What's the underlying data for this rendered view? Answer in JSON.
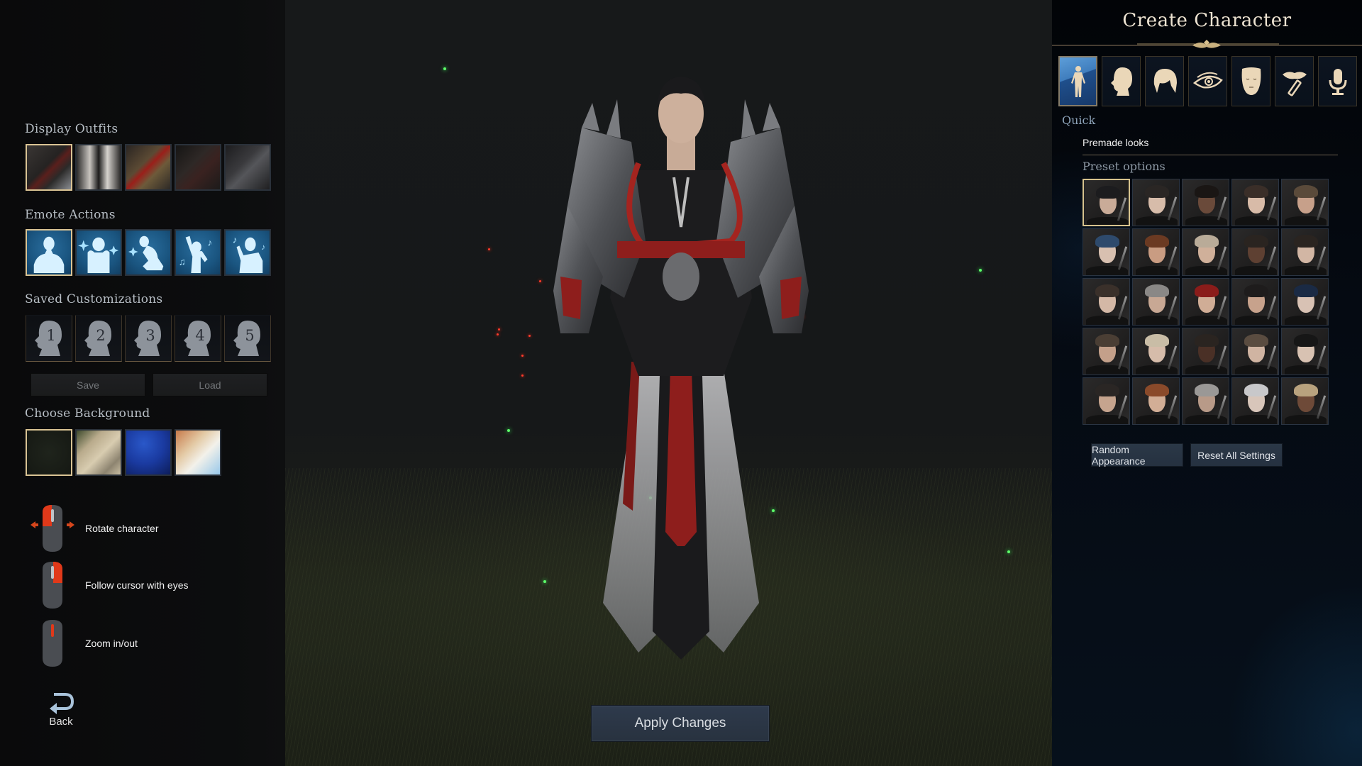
{
  "left_panel": {
    "display_outfits": {
      "title": "Display Outfits",
      "items": [
        {
          "name": "outfit-1",
          "selected": true
        },
        {
          "name": "outfit-2",
          "selected": false
        },
        {
          "name": "outfit-3",
          "selected": false
        },
        {
          "name": "outfit-4",
          "selected": false
        },
        {
          "name": "outfit-5",
          "selected": false
        }
      ]
    },
    "emote_actions": {
      "title": "Emote Actions",
      "items": [
        {
          "icon": "idle-pose-icon",
          "selected": true
        },
        {
          "icon": "shy-pose-icon",
          "selected": false
        },
        {
          "icon": "kneel-pose-icon",
          "selected": false
        },
        {
          "icon": "dance-pose-icon",
          "selected": false
        },
        {
          "icon": "sing-pose-icon",
          "selected": false
        }
      ]
    },
    "saved_customizations": {
      "title": "Saved Customizations",
      "slots": [
        "1",
        "2",
        "3",
        "4",
        "5"
      ],
      "save_label": "Save",
      "load_label": "Load"
    },
    "choose_background": {
      "title": "Choose Background",
      "items": [
        {
          "name": "night-meadow",
          "selected": true
        },
        {
          "name": "stone-plaza",
          "selected": false
        },
        {
          "name": "starry-blue",
          "selected": false
        },
        {
          "name": "beach",
          "selected": false
        }
      ]
    },
    "controls": [
      {
        "icon": "mouse-left-drag-icon",
        "label": "Rotate character"
      },
      {
        "icon": "mouse-right-click-icon",
        "label": "Follow cursor with eyes"
      },
      {
        "icon": "mouse-wheel-icon",
        "label": "Zoom in/out"
      }
    ],
    "back_label": "Back"
  },
  "center": {
    "apply_label": "Apply Changes"
  },
  "right_panel": {
    "title": "Create Character",
    "tabs": [
      {
        "icon": "body-icon",
        "selected": true
      },
      {
        "icon": "head-icon",
        "selected": false
      },
      {
        "icon": "hair-icon",
        "selected": false
      },
      {
        "icon": "eye-icon",
        "selected": false
      },
      {
        "icon": "face-icon",
        "selected": false
      },
      {
        "icon": "makeup-icon",
        "selected": false
      },
      {
        "icon": "voice-icon",
        "selected": false
      }
    ],
    "section_label": "Quick",
    "premade_label": "Premade looks",
    "preset_label": "Preset options",
    "presets": [
      {
        "skin": "#c9ab98",
        "hair": "#1c1c1e",
        "selected": true
      },
      {
        "skin": "#d7bcaa",
        "hair": "#2a2624"
      },
      {
        "skin": "#6a4a3a",
        "hair": "#1a1614"
      },
      {
        "skin": "#d8bba8",
        "hair": "#3a2e28"
      },
      {
        "skin": "#c7a08a",
        "hair": "#5a4a3a"
      },
      {
        "skin": "#d8c0b0",
        "hair": "#2e4a6c"
      },
      {
        "skin": "#c99c82",
        "hair": "#6b3a22"
      },
      {
        "skin": "#d0b09a",
        "hair": "#b9ab98"
      },
      {
        "skin": "#5e4032",
        "hair": "#2a2420"
      },
      {
        "skin": "#d2b6a4",
        "hair": "#2a2420"
      },
      {
        "skin": "#d4b8a6",
        "hair": "#3a302a"
      },
      {
        "skin": "#c8a894",
        "hair": "#8a8886"
      },
      {
        "skin": "#d0ad96",
        "hair": "#8a1c1a"
      },
      {
        "skin": "#c7a28c",
        "hair": "#1e1c1c"
      },
      {
        "skin": "#d8c2b4",
        "hair": "#1a2a44"
      },
      {
        "skin": "#c4a08a",
        "hair": "#4a3e34"
      },
      {
        "skin": "#d6bcaa",
        "hair": "#c9bda6"
      },
      {
        "skin": "#4a3026",
        "hair": "#2a2420"
      },
      {
        "skin": "#d0b4a2",
        "hair": "#5a4c40"
      },
      {
        "skin": "#d8c2b2",
        "hair": "#161616"
      },
      {
        "skin": "#c6a48e",
        "hair": "#2a2624"
      },
      {
        "skin": "#d2ae96",
        "hair": "#8a4a2a"
      },
      {
        "skin": "#b89a88",
        "hair": "#9a9896"
      },
      {
        "skin": "#d8c6ba",
        "hair": "#c8c8ca"
      },
      {
        "skin": "#6e4a38",
        "hair": "#b8a27e"
      }
    ],
    "random_label": "Random Appearance",
    "reset_label": "Reset All Settings"
  }
}
